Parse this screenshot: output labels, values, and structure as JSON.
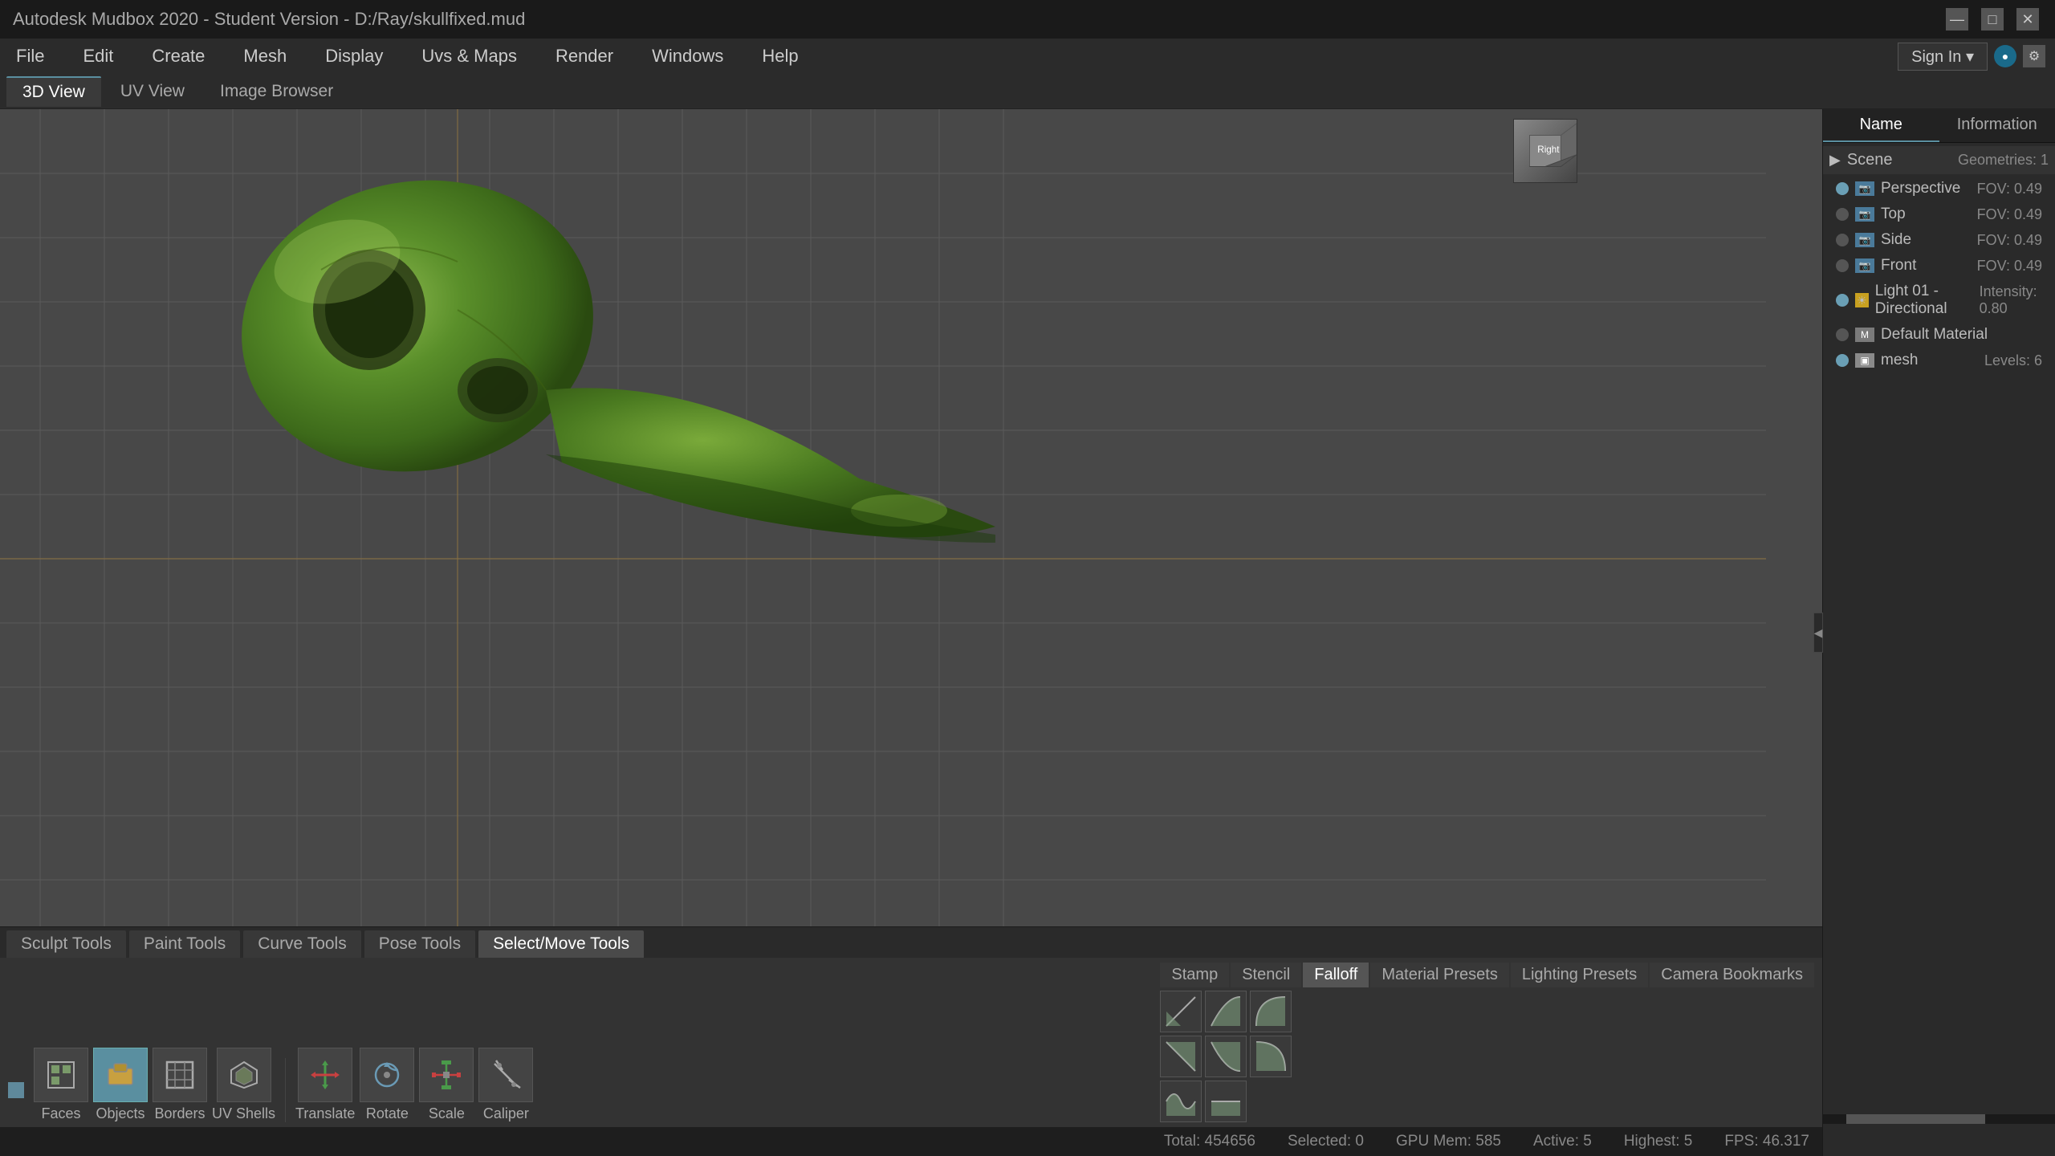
{
  "app": {
    "title": "Autodesk Mudbox 2020 - Student Version - D:/Ray/skullfixed.mud",
    "window_controls": [
      "—",
      "□",
      "✕"
    ]
  },
  "menu": {
    "items": [
      "File",
      "Edit",
      "Create",
      "Mesh",
      "Display",
      "Uvs & Maps",
      "Render",
      "Windows",
      "Help"
    ]
  },
  "tabs": {
    "items": [
      "3D View",
      "UV View",
      "Image Browser"
    ],
    "active": "3D View"
  },
  "signin": {
    "label": "Sign In",
    "arrow": "▾"
  },
  "right_panel": {
    "tabs": [
      "Name",
      "Information"
    ],
    "sections": [
      {
        "label": "Scene",
        "info": "Geometries: 1",
        "children": [
          {
            "label": "Perspective",
            "info": "FOV: 0.49",
            "icon": "camera"
          },
          {
            "label": "Top",
            "info": "FOV: 0.49",
            "icon": "camera"
          },
          {
            "label": "Side",
            "info": "FOV: 0.49",
            "icon": "camera"
          },
          {
            "label": "Front",
            "info": "FOV: 0.49",
            "icon": "camera"
          },
          {
            "label": "Light 01 - Directional",
            "info": "Intensity: 0.80",
            "icon": "light"
          },
          {
            "label": "Default Material",
            "info": "",
            "icon": "material"
          },
          {
            "label": "mesh",
            "info": "Levels: 6",
            "icon": "mesh"
          }
        ]
      }
    ]
  },
  "tool_tabs": {
    "items": [
      "Sculpt Tools",
      "Paint Tools",
      "Curve Tools",
      "Pose Tools",
      "Select/Move Tools"
    ],
    "active": "Select/Move Tools"
  },
  "tools": {
    "groups": [
      {
        "label": "Faces",
        "icon": "faces-icon"
      },
      {
        "label": "Objects",
        "icon": "objects-icon",
        "active": true
      },
      {
        "label": "Borders",
        "icon": "borders-icon"
      },
      {
        "label": "UV Shells",
        "icon": "uvshells-icon"
      }
    ],
    "transforms": [
      {
        "label": "Translate",
        "icon": "translate-icon"
      },
      {
        "label": "Rotate",
        "icon": "rotate-icon"
      },
      {
        "label": "Scale",
        "icon": "scale-icon"
      },
      {
        "label": "Caliper",
        "icon": "caliper-icon"
      }
    ]
  },
  "falloff_panel": {
    "tabs": [
      "Stamp",
      "Stencil",
      "Falloff",
      "Material Presets",
      "Lighting Presets",
      "Camera Bookmarks"
    ],
    "active": "Falloff",
    "icons": [
      "falloff-linear",
      "falloff-smooth",
      "falloff-sharp",
      "falloff-inv-linear",
      "falloff-inv-smooth",
      "falloff-inv-sharp",
      "falloff-custom",
      "falloff-flat"
    ]
  },
  "status_bar": {
    "total": "Total: 454656",
    "selected": "Selected: 0",
    "gpu_mem": "GPU Mem: 585",
    "active": "Active: 5",
    "highest": "Highest: 5",
    "fps": "FPS: 46.317"
  },
  "nav_cube": {
    "label": "Right"
  },
  "viewport": {
    "background": "#484848"
  }
}
